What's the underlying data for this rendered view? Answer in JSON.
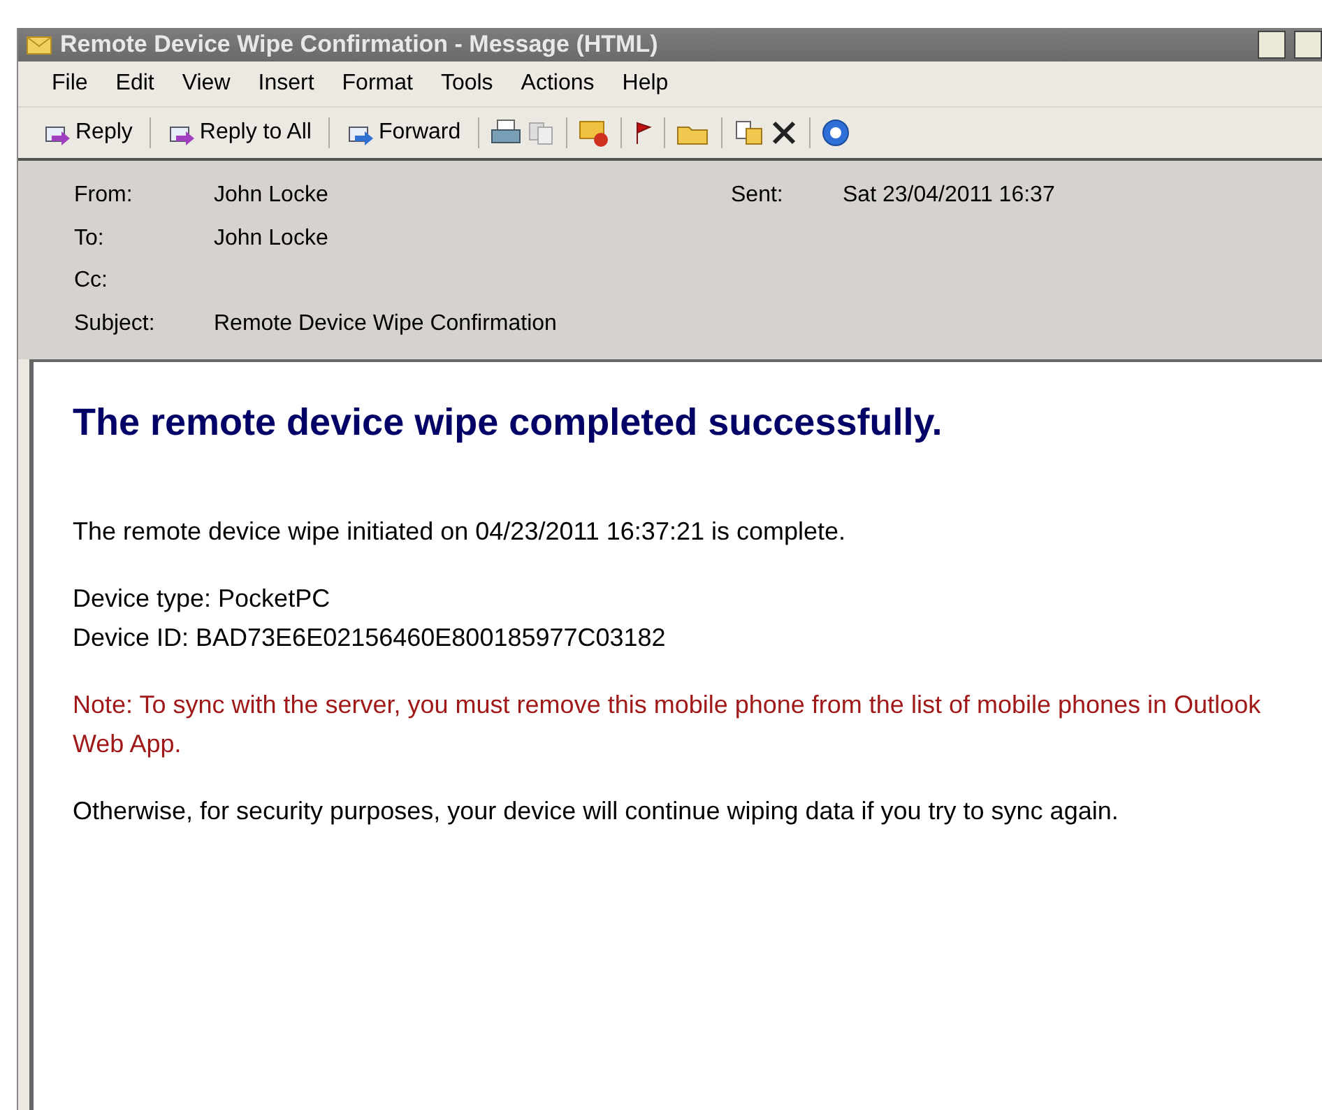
{
  "window": {
    "title": "Remote Device Wipe Confirmation - Message (HTML)"
  },
  "menu": [
    "File",
    "Edit",
    "View",
    "Insert",
    "Format",
    "Tools",
    "Actions",
    "Help"
  ],
  "toolbar": [
    {
      "label": "Reply"
    },
    {
      "label": "Reply to All"
    },
    {
      "label": "Forward"
    }
  ],
  "header": {
    "from_label": "From:",
    "from": "John Locke",
    "sent_label": "Sent:",
    "sent": "Sat 23/04/2011 16:37",
    "to_label": "To:",
    "to": "John Locke",
    "cc_label": "Cc:",
    "subject_label": "Subject:",
    "subject": "Remote Device Wipe Confirmation"
  },
  "body": [
    {
      "kind": "heading",
      "lines": [
        "The remote device wipe completed successfully."
      ]
    },
    {
      "kind": "text",
      "lines": [
        "The remote device wipe initiated on 04/23/2011 16:37:21 is complete."
      ]
    },
    {
      "kind": "text",
      "lines": [
        "Device type: PocketPC",
        "Device ID: BAD73E6E02156460E800185977C03182"
      ]
    },
    {
      "kind": "note",
      "lines": [
        "Note: To sync with the server, you must remove this mobile phone from the list of mobile phones in Outlook Web App."
      ]
    },
    {
      "kind": "text",
      "lines": [
        "Otherwise, for security purposes, your device will continue wiping data if you try to sync again."
      ]
    }
  ]
}
